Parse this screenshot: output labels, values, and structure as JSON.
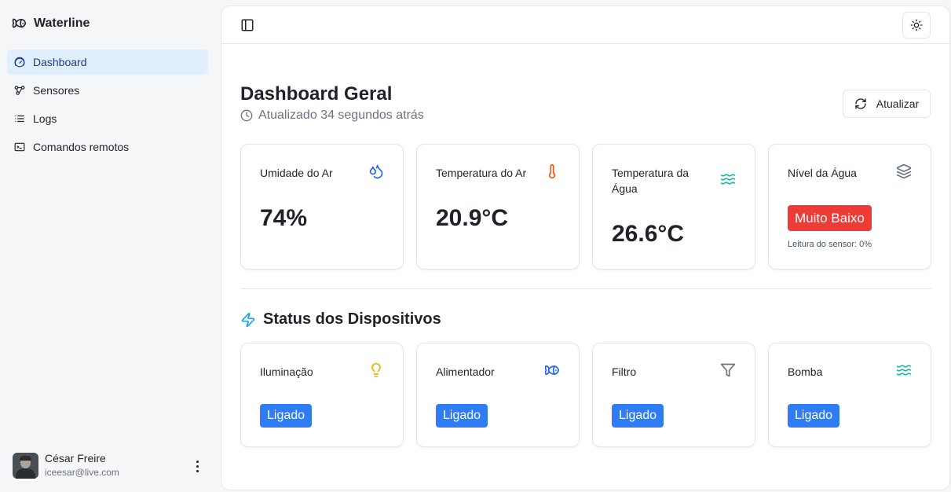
{
  "app": {
    "name": "Waterline"
  },
  "sidebar": {
    "items": [
      {
        "label": "Dashboard",
        "icon": "gauge-icon",
        "active": true
      },
      {
        "label": "Sensores",
        "icon": "nodes-icon"
      },
      {
        "label": "Logs",
        "icon": "list-icon"
      },
      {
        "label": "Comandos remotos",
        "icon": "terminal-icon"
      }
    ]
  },
  "user": {
    "name": "César Freire",
    "email": "iceesar@live.com"
  },
  "header": {
    "title": "Dashboard Geral",
    "updated": "Atualizado 34 segundos atrás",
    "refresh_label": "Atualizar"
  },
  "sensors": [
    {
      "label": "Umidade do Ar",
      "value": "74%",
      "icon": "droplets-icon",
      "color": "#2563eb"
    },
    {
      "label": "Temperatura do Ar",
      "value": "20.9°C",
      "icon": "thermometer-icon",
      "color": "#ea580c"
    },
    {
      "label": "Temperatura da Água",
      "value": "26.6°C",
      "icon": "waves-icon",
      "color": "#14b8a6"
    },
    {
      "label": "Nível da Água",
      "status": "Muito Baixo",
      "reading": "Leitura do sensor: 0%",
      "icon": "layers-icon",
      "color": "#6b7280",
      "status_color": "#ef3b36"
    }
  ],
  "devices_section": {
    "title": "Status dos Dispositivos",
    "icon": "zap-icon"
  },
  "devices": [
    {
      "label": "Iluminação",
      "status": "Ligado",
      "icon": "lightbulb-icon",
      "color": "#eab308"
    },
    {
      "label": "Alimentador",
      "status": "Ligado",
      "icon": "fish-icon",
      "color": "#2563eb"
    },
    {
      "label": "Filtro",
      "status": "Ligado",
      "icon": "filter-icon",
      "color": "#6b7280"
    },
    {
      "label": "Bomba",
      "status": "Ligado",
      "icon": "waves-icon",
      "color": "#14b8a6"
    }
  ],
  "colors": {
    "accent_blue": "#2f7df6",
    "danger_red": "#ef3b36",
    "active_nav_bg": "#e0effd"
  }
}
